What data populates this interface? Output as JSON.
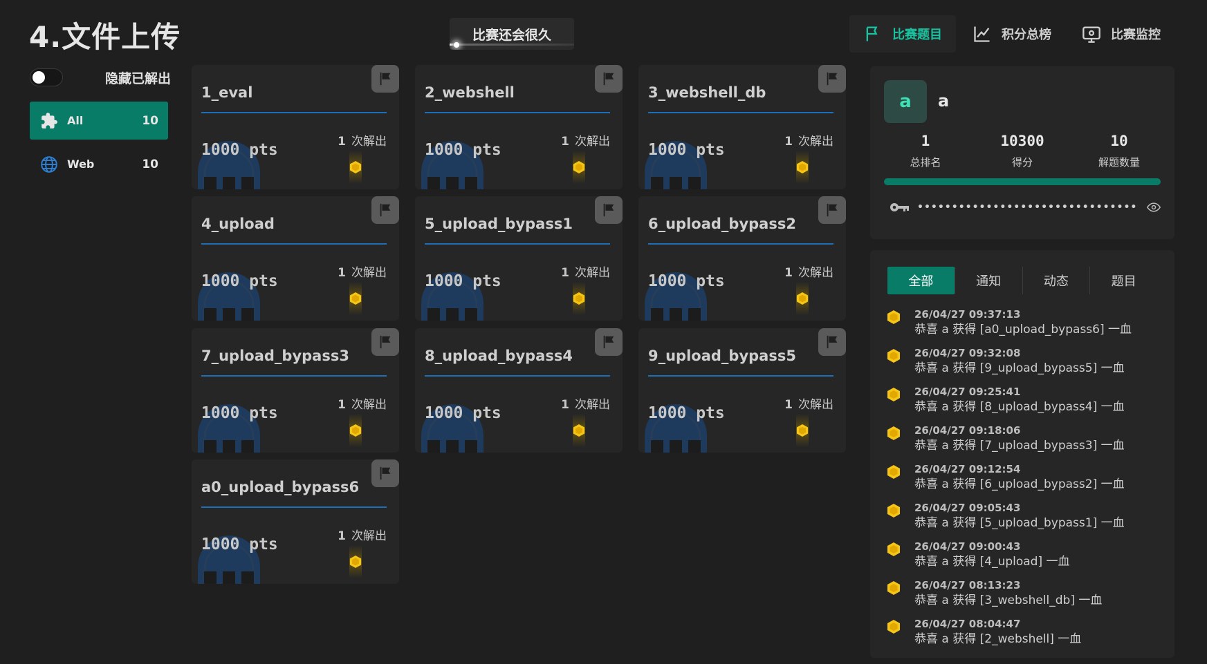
{
  "page": {
    "title": "4.文件上传"
  },
  "status": {
    "label": "比赛还会很久"
  },
  "nav": {
    "items": [
      {
        "label": "比赛题目",
        "icon": "flag-icon",
        "active": true
      },
      {
        "label": "积分总榜",
        "icon": "chart-line-icon",
        "active": false
      },
      {
        "label": "比赛监控",
        "icon": "monitor-eye-icon",
        "active": false
      }
    ]
  },
  "sidebar": {
    "hide_solved_label": "隐藏已解出",
    "categories": [
      {
        "name": "All",
        "count": "10",
        "icon": "puzzle-icon",
        "active": true
      },
      {
        "name": "Web",
        "count": "10",
        "icon": "globe-icon",
        "active": false
      }
    ]
  },
  "challenges": [
    {
      "name": "1_eval",
      "points": "1000 pts",
      "solves": "1",
      "solves_label": "次解出"
    },
    {
      "name": "2_webshell",
      "points": "1000 pts",
      "solves": "1",
      "solves_label": "次解出"
    },
    {
      "name": "3_webshell_db",
      "points": "1000 pts",
      "solves": "1",
      "solves_label": "次解出"
    },
    {
      "name": "4_upload",
      "points": "1000 pts",
      "solves": "1",
      "solves_label": "次解出"
    },
    {
      "name": "5_upload_bypass1",
      "points": "1000 pts",
      "solves": "1",
      "solves_label": "次解出"
    },
    {
      "name": "6_upload_bypass2",
      "points": "1000 pts",
      "solves": "1",
      "solves_label": "次解出"
    },
    {
      "name": "7_upload_bypass3",
      "points": "1000 pts",
      "solves": "1",
      "solves_label": "次解出"
    },
    {
      "name": "8_upload_bypass4",
      "points": "1000 pts",
      "solves": "1",
      "solves_label": "次解出"
    },
    {
      "name": "9_upload_bypass5",
      "points": "1000 pts",
      "solves": "1",
      "solves_label": "次解出"
    },
    {
      "name": "a0_upload_bypass6",
      "points": "1000 pts",
      "solves": "1",
      "solves_label": "次解出"
    }
  ],
  "profile": {
    "avatar_letter": "a",
    "username": "a",
    "rank": "1",
    "rank_label": "总排名",
    "score": "10300",
    "score_label": "得分",
    "solved": "10",
    "solved_label": "解题数量",
    "progress": 1.0,
    "masked_key": "••••••••••••••••••••••••••••••••"
  },
  "feed": {
    "tabs": [
      {
        "label": "全部",
        "active": true
      },
      {
        "label": "通知",
        "active": false
      },
      {
        "label": "动态",
        "active": false
      },
      {
        "label": "题目",
        "active": false
      }
    ],
    "events": [
      {
        "time": "26/04/27 09:37:13",
        "message": "恭喜 a 获得 [a0_upload_bypass6] 一血"
      },
      {
        "time": "26/04/27 09:32:08",
        "message": "恭喜 a 获得 [9_upload_bypass5] 一血"
      },
      {
        "time": "26/04/27 09:25:41",
        "message": "恭喜 a 获得 [8_upload_bypass4] 一血"
      },
      {
        "time": "26/04/27 09:18:06",
        "message": "恭喜 a 获得 [7_upload_bypass3] 一血"
      },
      {
        "time": "26/04/27 09:12:54",
        "message": "恭喜 a 获得 [6_upload_bypass2] 一血"
      },
      {
        "time": "26/04/27 09:05:43",
        "message": "恭喜 a 获得 [5_upload_bypass1] 一血"
      },
      {
        "time": "26/04/27 09:00:43",
        "message": "恭喜 a 获得 [4_upload] 一血"
      },
      {
        "time": "26/04/27 08:13:23",
        "message": "恭喜 a 获得 [3_webshell_db] 一血"
      },
      {
        "time": "26/04/27 08:04:47",
        "message": "恭喜 a 获得 [2_webshell] 一血"
      }
    ]
  },
  "colors": {
    "accent": "#097c68",
    "accent_text": "#19c3a0",
    "medal": "#f5c518",
    "underline": "#1e6fb8"
  }
}
